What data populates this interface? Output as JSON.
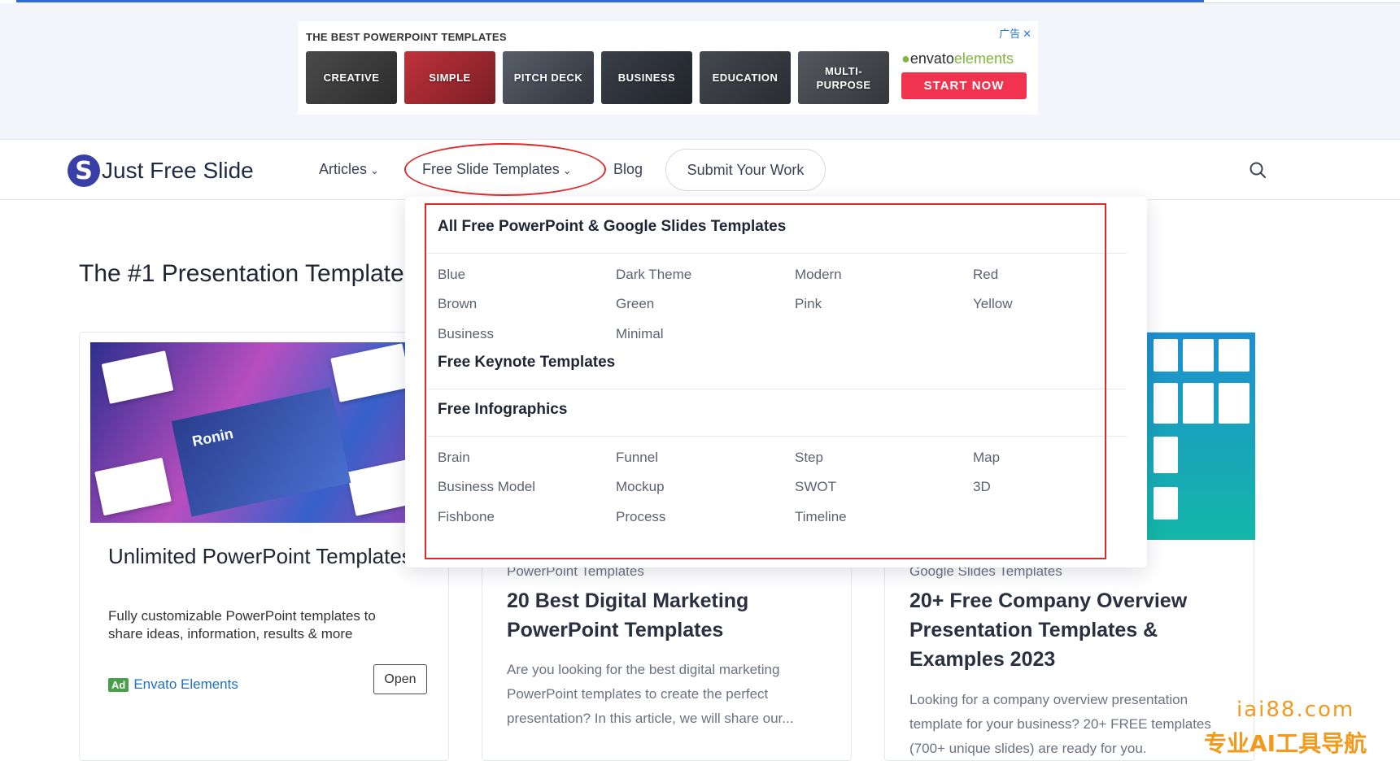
{
  "ad": {
    "heading": "THE BEST POWERPOINT TEMPLATES",
    "badge": "广告",
    "close": "✕",
    "tiles": [
      "CREATIVE",
      "SIMPLE",
      "PITCH DECK",
      "BUSINESS",
      "EDUCATION",
      "MULTI-\nPURPOSE"
    ],
    "brand_prefix": "envato",
    "brand_suffix": "elements",
    "cta": "START NOW"
  },
  "nav": {
    "logo_text": "Just Free Slide",
    "logo_mark": "S",
    "articles": "Articles",
    "free_slide_templates": "Free Slide Templates",
    "blog": "Blog",
    "submit": "Submit Your Work"
  },
  "page": {
    "heading": "The #1 Presentation Template"
  },
  "dropdown": {
    "section1": "All Free PowerPoint & Google Slides Templates",
    "colors_col1": [
      "Blue",
      "Brown",
      "Business"
    ],
    "colors_col2": [
      "Dark Theme",
      "Green",
      "Minimal"
    ],
    "colors_col3": [
      "Modern",
      "Pink"
    ],
    "colors_col4": [
      "Red",
      "Yellow"
    ],
    "section2": "Free Keynote Templates",
    "section3": "Free Infographics",
    "info_col1": [
      "Brain",
      "Business Model",
      "Fishbone"
    ],
    "info_col2": [
      "Funnel",
      "Mockup",
      "Process"
    ],
    "info_col3": [
      "Step",
      "SWOT",
      "Timeline"
    ],
    "info_col4": [
      "Map",
      "3D"
    ]
  },
  "cards": {
    "ad_card": {
      "title": "Unlimited PowerPoint Templates",
      "description": "Fully customizable PowerPoint templates to share ideas, information, results & more",
      "ad_chip": "Ad",
      "advertiser": "Envato Elements",
      "open": "Open",
      "image_caption": "Ronin"
    },
    "card2": {
      "category": "PowerPoint Templates",
      "title": "20 Best Digital Marketing PowerPoint Templates",
      "description": "Are you looking for the best digital marketing PowerPoint templates to create the perfect presentation? In this article, we will share our..."
    },
    "card3": {
      "category": "Google Slides Templates",
      "title": "20+ Free Company Overview Presentation Templates & Examples 2023",
      "description": "Looking for a company overview presentation template for your business? 20+ FREE templates (700+ unique slides) are ready for you."
    }
  },
  "watermark": {
    "line1": "iai88.com",
    "line2": "专业AI工具导航"
  },
  "colors": {
    "accent_red": "#e02a2a",
    "cta_pink": "#f0344f",
    "envato_green": "#82b541",
    "link_blue": "#1e6fbf"
  }
}
